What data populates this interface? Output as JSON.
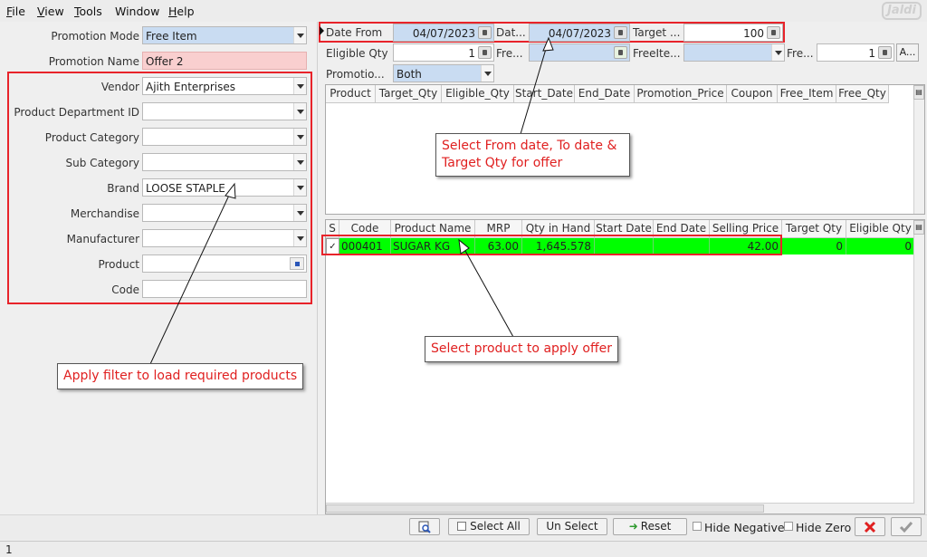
{
  "menu": [
    "File",
    "View",
    "Tools",
    "Window",
    "Help"
  ],
  "menu_accel": [
    "F",
    "V",
    "T",
    "W",
    "H"
  ],
  "logo_text": "Jaldi",
  "left_form": {
    "promotion_mode": {
      "label": "Promotion Mode",
      "value": "Free Item"
    },
    "promotion_name": {
      "label": "Promotion Name",
      "value": "Offer 2"
    },
    "vendor": {
      "label": "Vendor",
      "value": "Ajith Enterprises"
    },
    "product_department": {
      "label": "Product Department ID",
      "value": ""
    },
    "product_category": {
      "label": "Product Category",
      "value": ""
    },
    "sub_category": {
      "label": "Sub Category",
      "value": ""
    },
    "brand": {
      "label": "Brand",
      "value": "LOOSE STAPLE"
    },
    "merchandise": {
      "label": "Merchandise",
      "value": ""
    },
    "manufacturer": {
      "label": "Manufacturer",
      "value": ""
    },
    "product": {
      "label": "Product",
      "value": ""
    },
    "code": {
      "label": "Code",
      "value": ""
    }
  },
  "params": {
    "date_from_label": "Date From",
    "date_from_value": "04/07/2023",
    "date_to_label": "Dat...",
    "date_to_value": "04/07/2023",
    "target_label": "Target ...",
    "target_value": "100",
    "eligible_qty_label": "Eligible Qty",
    "eligible_qty_value": "1",
    "free_label": "Fre...",
    "free_item_label": "FreeIte...",
    "free_qty_label": "Fre...",
    "free_qty_value": "1",
    "apply_short": "A...",
    "promotion_label": "Promotio...",
    "promotion_value": "Both"
  },
  "promo_grid": {
    "headers": [
      "Product",
      "Target_Qty",
      "Eligible_Qty",
      "Start_Date",
      "End_Date",
      "Promotion_Price",
      "Coupon",
      "Free_Item",
      "Free_Qty"
    ]
  },
  "product_grid": {
    "headers": [
      "S",
      "Code",
      "Product Name",
      "MRP",
      "Qty in Hand",
      "Start Date",
      "End Date",
      "Selling Price",
      "Target Qty",
      "Eligible Qty"
    ],
    "rows": [
      {
        "selected": "✓",
        "code": "000401",
        "name": "SUGAR KG",
        "mrp": "63.00",
        "qty": "1,645.578",
        "start": "",
        "end": "",
        "price": "42.00",
        "target": "0",
        "eligible": "0"
      }
    ]
  },
  "callouts": {
    "dates": "Select From date, To date & Target Qty for offer",
    "product": "Select product to apply offer",
    "filter": "Apply filter to load required products"
  },
  "toolbar": {
    "select_all": "Select All",
    "unselect": "Un Select",
    "reset": "Reset",
    "hide_negative": "Hide Negative",
    "hide_zero": "Hide Zero"
  },
  "status": "1",
  "colors": {
    "highlight_row": "#00ff00",
    "annotation_red": "#e8232a",
    "field_blue": "#c9dcf2",
    "field_pink": "#f9cfcf"
  }
}
